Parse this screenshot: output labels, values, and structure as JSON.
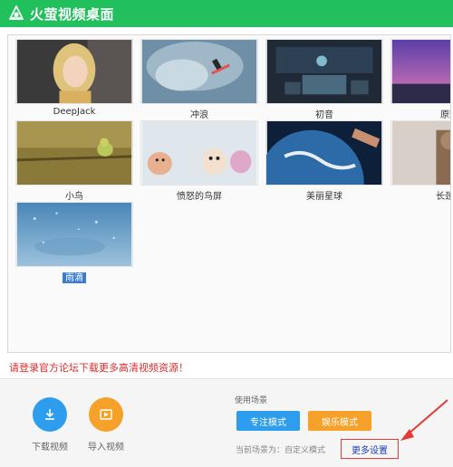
{
  "app": {
    "title": "火萤视频桌面"
  },
  "gallery": {
    "items": [
      {
        "label": "DeepJack",
        "selected": false
      },
      {
        "label": "冲浪",
        "selected": false
      },
      {
        "label": "初音",
        "selected": false
      },
      {
        "label": "原野",
        "selected": false
      },
      {
        "label": "小鸟",
        "selected": false
      },
      {
        "label": "愤怒的鸟屏",
        "selected": false
      },
      {
        "label": "美丽星球",
        "selected": false
      },
      {
        "label": "长颈鹿",
        "selected": false
      },
      {
        "label": "雨滴",
        "selected": true
      }
    ]
  },
  "notice": "请登录官方论坛下载更多高清视频资源！",
  "actions": {
    "download_label": "下载视频",
    "import_label": "导入视频"
  },
  "scene": {
    "section_label": "使用场景",
    "focus_mode": "专注模式",
    "fun_mode": "娱乐模式",
    "current_text": "当前场景为：自定义模式",
    "more_settings": "更多设置"
  },
  "colors": {
    "titlebar": "#21c05c",
    "primary_blue": "#2f9ded",
    "accent_orange": "#f6a12a",
    "notice_red": "#e22b2b"
  }
}
